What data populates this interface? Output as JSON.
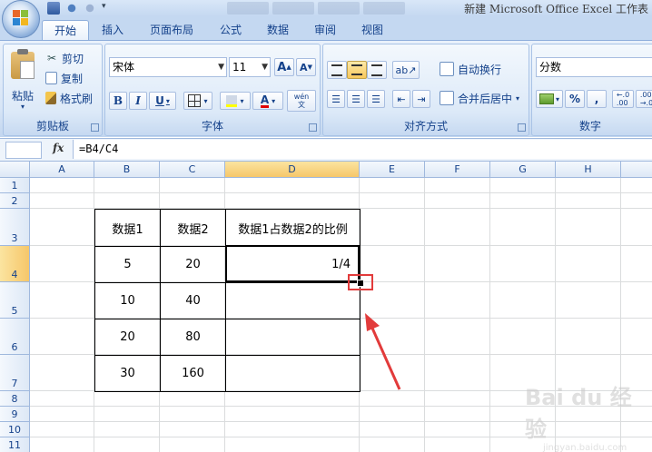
{
  "titlebar": {
    "title": "新建 Microsoft Office Excel 工作表"
  },
  "tabs": [
    "开始",
    "插入",
    "页面布局",
    "公式",
    "数据",
    "审阅",
    "视图"
  ],
  "clipboard": {
    "paste": "粘贴",
    "cut": "剪切",
    "copy": "复制",
    "format_painter": "格式刷",
    "label": "剪贴板"
  },
  "font": {
    "name": "宋体",
    "size": "11",
    "bold": "B",
    "italic": "I",
    "underline": "U",
    "color_letter": "A",
    "wen": "wén\n文",
    "label": "字体"
  },
  "alignment": {
    "wrap": "自动换行",
    "merge": "合并后居中",
    "label": "对齐方式"
  },
  "number": {
    "format": "分数",
    "pct": "%",
    "comma": ",",
    "label": "数字"
  },
  "formula_bar": {
    "fx": "fx",
    "formula": "=B4/C4"
  },
  "columns": [
    "A",
    "B",
    "C",
    "D",
    "E",
    "F",
    "G",
    "H"
  ],
  "rows": [
    "1",
    "2",
    "3",
    "4",
    "5",
    "6",
    "7",
    "8",
    "9",
    "10",
    "11"
  ],
  "table": {
    "headers": [
      "数据1",
      "数据2",
      "数据1占数据2的比例"
    ],
    "rows": [
      [
        "5",
        "20",
        "1/4"
      ],
      [
        "10",
        "40",
        ""
      ],
      [
        "20",
        "80",
        ""
      ],
      [
        "30",
        "160",
        ""
      ]
    ]
  },
  "watermark": {
    "brand": "Bai du 经验",
    "url": "jingyan.baidu.com"
  },
  "colors": {
    "accent": "#15428b",
    "selected": "#f6c76a",
    "annotation": "#e23b3b"
  }
}
